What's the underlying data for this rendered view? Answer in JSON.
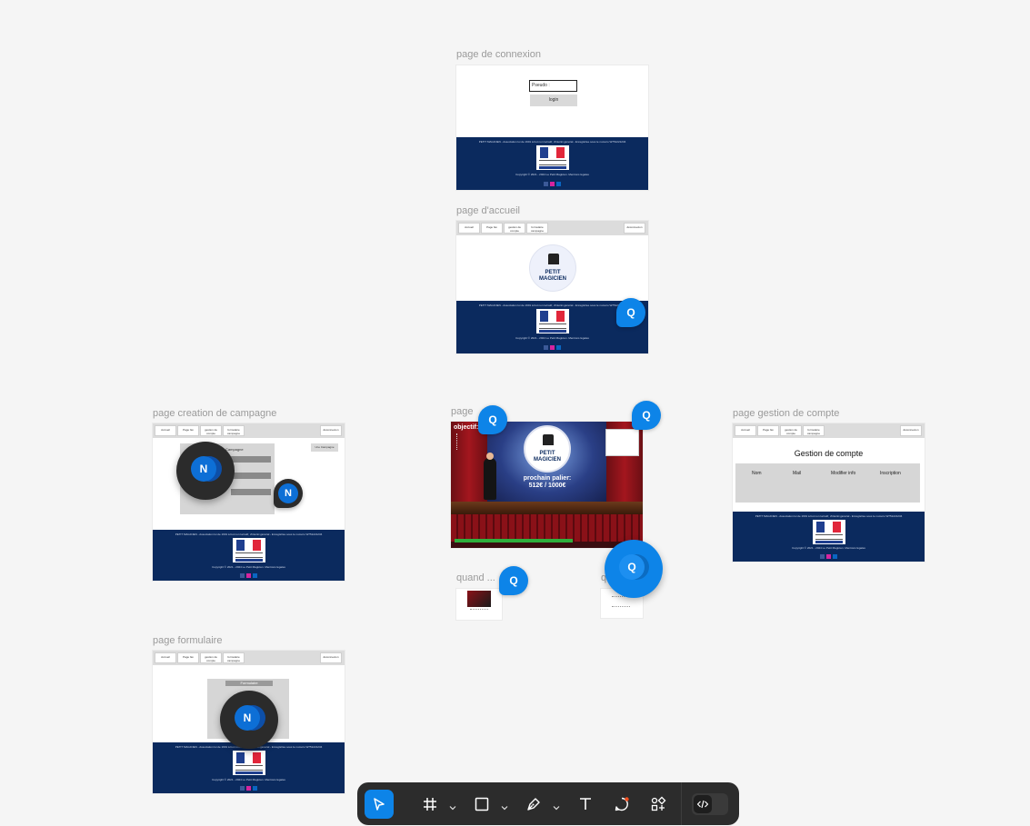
{
  "frames": {
    "connexion": {
      "label": "page de connexion",
      "pseudo_placeholder": "Pseudo :",
      "login_label": "login"
    },
    "accueil": {
      "label": "page d'accueil",
      "logo_line1": "PETIT",
      "logo_line2": "MAGICIEN"
    },
    "creation": {
      "label": "page creation de campagne",
      "new_campaign_label": "Une Campagne",
      "campaign_title": "Campagne"
    },
    "stage": {
      "label": "page",
      "objectif_label": "objectif:",
      "palier_label": "prochain palier:",
      "palier_value": "512€ / 1000€",
      "logo_line1": "PETIT",
      "logo_line2": "MAGICIEN"
    },
    "gestion": {
      "label": "page gestion de compte",
      "title": "Gestion de compte",
      "columns": [
        "Nom",
        "Mail",
        "Modifier info",
        "Inscription"
      ]
    },
    "formulaire": {
      "label": "page formulaire",
      "form_title": "Formulaire"
    },
    "quand1": {
      "label": "quand ..."
    },
    "quand2": {
      "label": "q"
    }
  },
  "nav": {
    "items": [
      "Accueil",
      "Page fav",
      "gestion de compte",
      "formulaire campagne"
    ],
    "logout": "déconnexion"
  },
  "footer": {
    "text": "PETIT MAGICIEN - Association loi de 1901 à but non lucratif, d'intérêt général - Enregistrée sous le numéro W751221234",
    "copyright": "Copyright © 2021 - 2024 Le Petit Magicien. Mentions légales"
  },
  "avatars": {
    "q": "Q",
    "n": "N"
  },
  "colors": {
    "footer_navy": "#0b2a5e",
    "accent_blue": "#0d84e8",
    "toolbar": "#2c2c2c"
  },
  "toolbar": {
    "tools": [
      "move-tool",
      "frame-tool",
      "rectangle-tool",
      "pen-tool",
      "text-tool",
      "comment-tool",
      "actions-tool"
    ],
    "dev_mode": "dev-mode-toggle"
  }
}
